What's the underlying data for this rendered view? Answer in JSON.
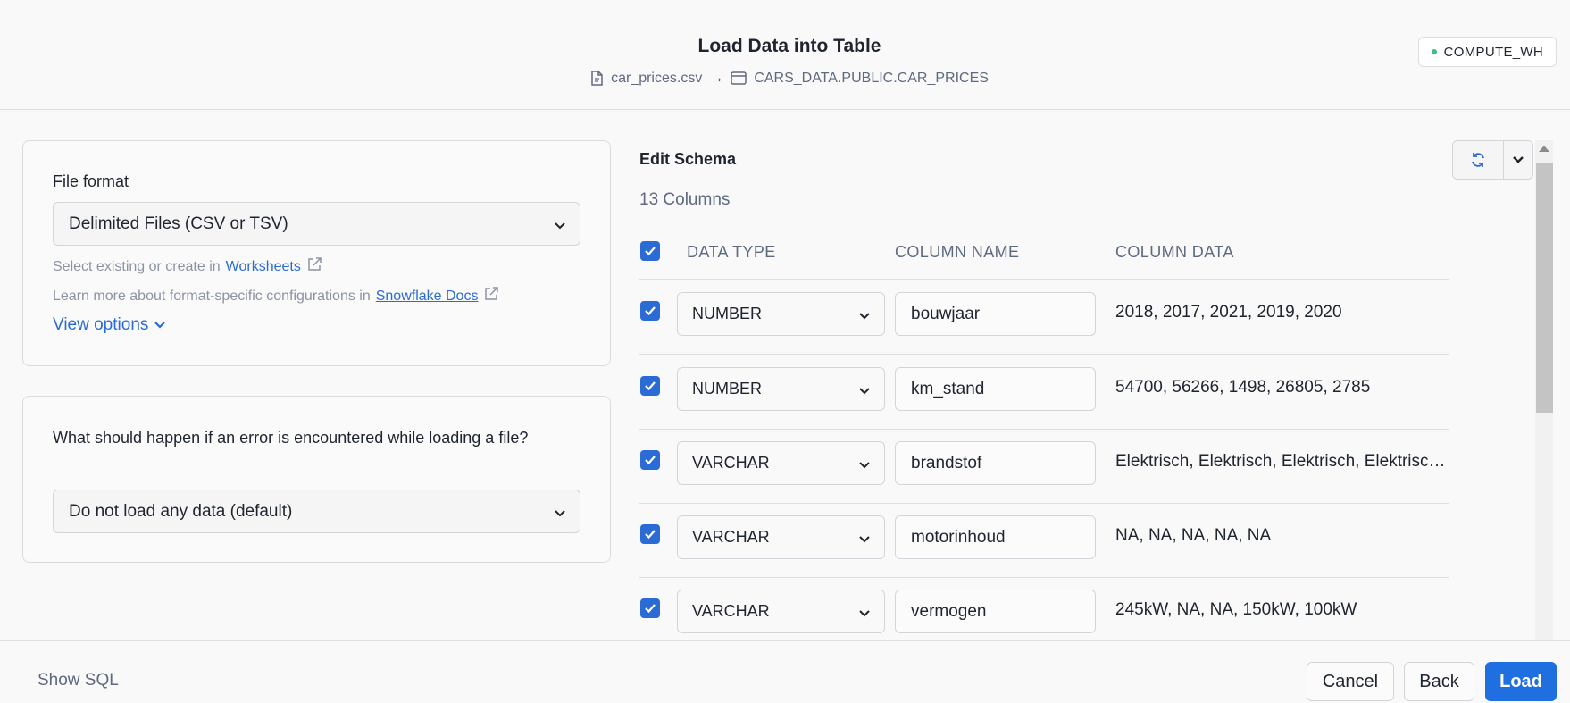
{
  "header": {
    "title": "Load Data into Table",
    "source_file": "car_prices.csv",
    "arrow": "→",
    "target_table": "CARS_DATA.PUBLIC.CAR_PRICES",
    "warehouse": "COMPUTE_WH",
    "warehouse_status_color": "#3fbf7f"
  },
  "file_format": {
    "label": "File format",
    "value": "Delimited Files (CSV or TSV)",
    "helper1_prefix": "Select existing or create in",
    "helper1_link": "Worksheets",
    "helper2_prefix": "Learn more about format-specific configurations in",
    "helper2_link": "Snowflake Docs",
    "view_options": "View options"
  },
  "error_handling": {
    "question": "What should happen if an error is encountered while loading a file?",
    "value": "Do not load any data (default)"
  },
  "schema": {
    "title": "Edit Schema",
    "column_count": "13 Columns",
    "headers": {
      "data_type": "DATA TYPE",
      "column_name": "COLUMN NAME",
      "column_data": "COLUMN DATA"
    },
    "rows": [
      {
        "data_type": "NUMBER",
        "column_name": "bouwjaar",
        "column_data": "2018, 2017, 2021, 2019, 2020"
      },
      {
        "data_type": "NUMBER",
        "column_name": "km_stand",
        "column_data": "54700, 56266, 1498, 26805, 2785"
      },
      {
        "data_type": "VARCHAR",
        "column_name": "brandstof",
        "column_data": "Elektrisch, Elektrisch, Elektrisch, Elektrisch, Elektrisch"
      },
      {
        "data_type": "VARCHAR",
        "column_name": "motorinhoud",
        "column_data": "NA, NA, NA, NA, NA"
      },
      {
        "data_type": "VARCHAR",
        "column_name": "vermogen",
        "column_data": "245kW, NA, NA, 150kW, 100kW"
      }
    ]
  },
  "footer": {
    "show_sql": "Show SQL",
    "cancel": "Cancel",
    "back": "Back",
    "load": "Load"
  },
  "colors": {
    "accent": "#1f6fe0",
    "link": "#2a6bd6",
    "checkbox": "#2a6bd6"
  }
}
